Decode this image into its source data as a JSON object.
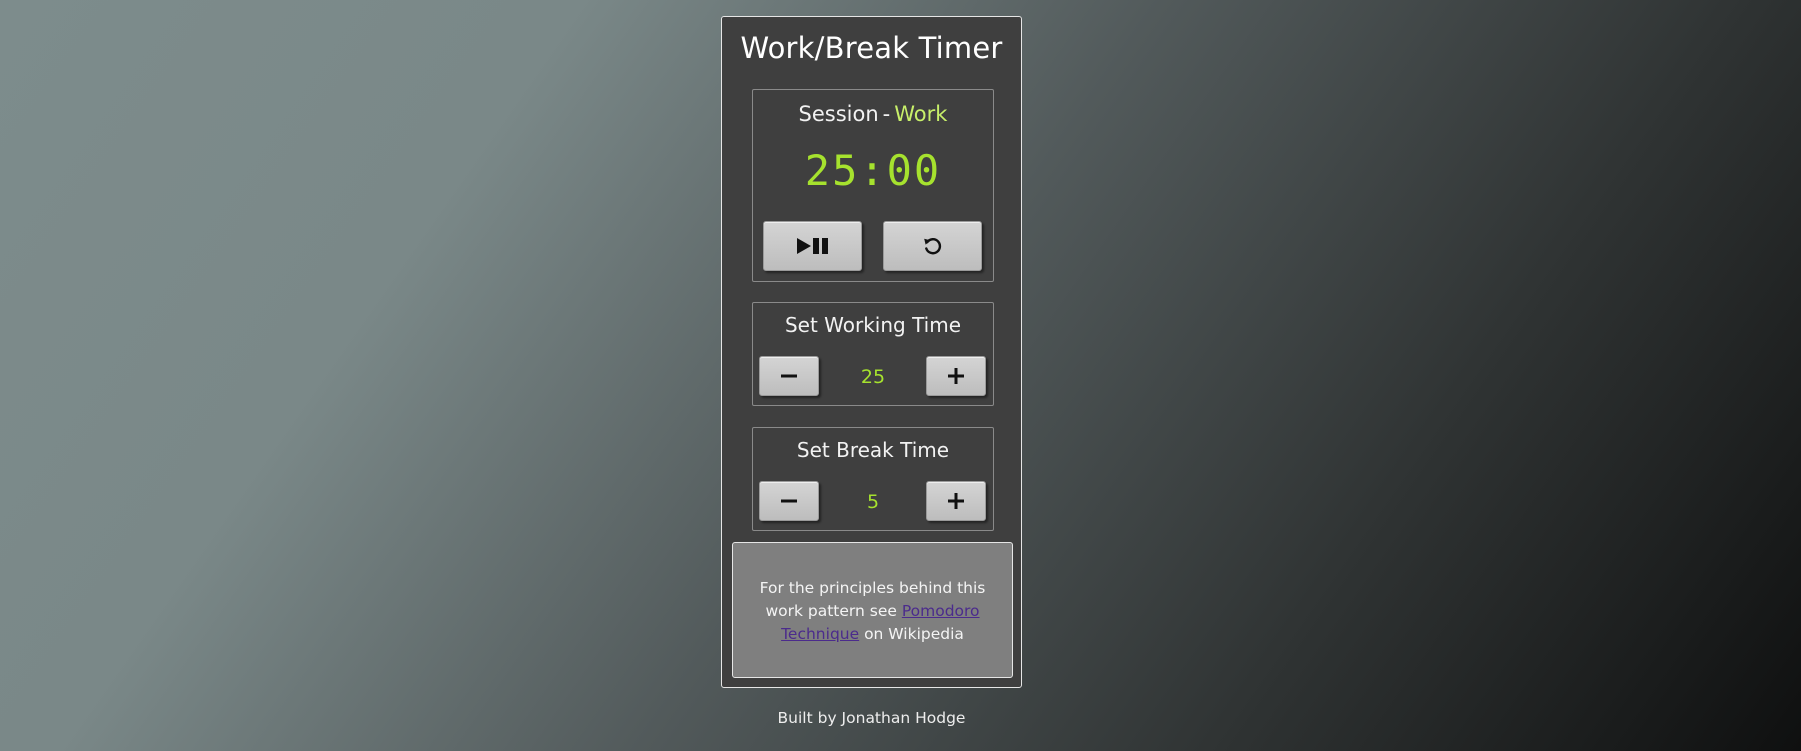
{
  "app": {
    "title": "Work/Break Timer"
  },
  "session": {
    "label": "Session",
    "separator": "-",
    "type": "Work",
    "time": "25:00",
    "play_pause_icon": "play-pause-icon",
    "reset_icon": "reset-icon"
  },
  "work_setting": {
    "title": "Set Working Time",
    "value": "25",
    "decrement_icon": "minus-icon",
    "increment_icon": "plus-icon"
  },
  "break_setting": {
    "title": "Set Break Time",
    "value": "5",
    "decrement_icon": "minus-icon",
    "increment_icon": "plus-icon"
  },
  "info": {
    "text_before": "For the principles behind this work pattern see",
    "link_text": "Pomodoro Technique",
    "text_after": "on Wikipedia"
  },
  "footer": {
    "text": "Built by Jonathan Hodge"
  },
  "colors": {
    "accent": "#a6e22e",
    "session_type": "#c8f06a",
    "panel_bg": "#3f3f3f",
    "info_bg": "#7f7f7f",
    "link": "#4b2b8c"
  }
}
